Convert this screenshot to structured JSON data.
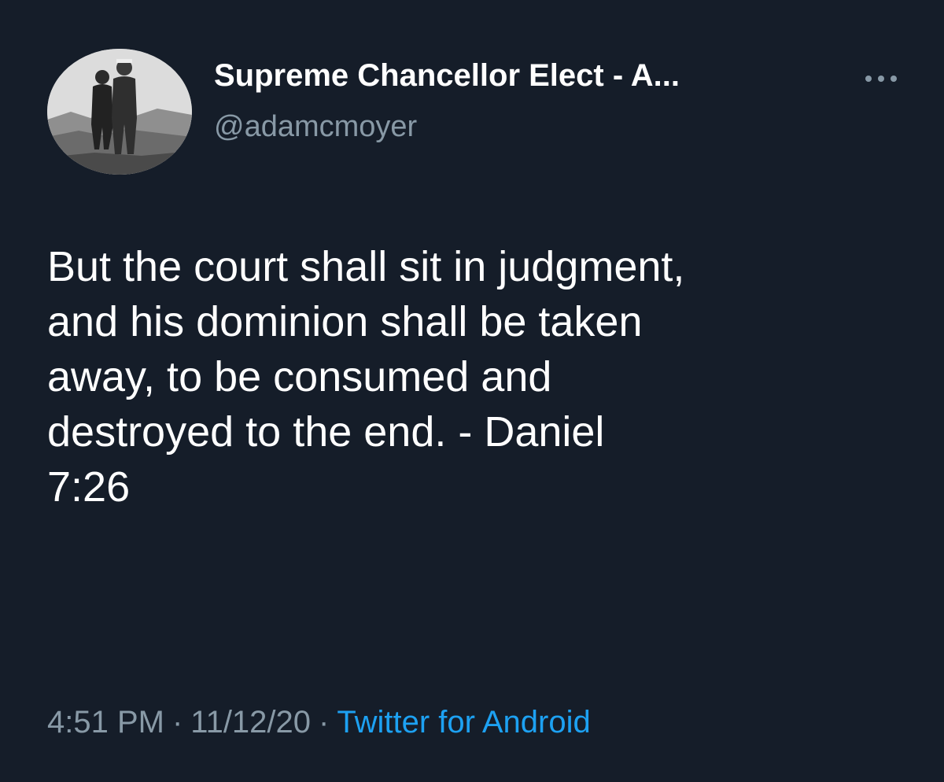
{
  "tweet": {
    "display_name": "Supreme Chancellor Elect - A...",
    "handle": "@adamcmoyer",
    "text": "But the court shall sit in judgment,\nand his dominion shall be taken\naway, to be consumed and\ndestroyed to the end. - Daniel\n7:26",
    "time": "4:51 PM",
    "separator": "·",
    "date": "11/12/20",
    "source": "Twitter for Android",
    "more_icon": "more-horizontal-icon",
    "avatar_icon": "profile-photo-avatar"
  },
  "colors": {
    "background": "#151d29",
    "primary_text": "#ffffff",
    "secondary_text": "#8899a6",
    "link": "#1da1f2"
  }
}
